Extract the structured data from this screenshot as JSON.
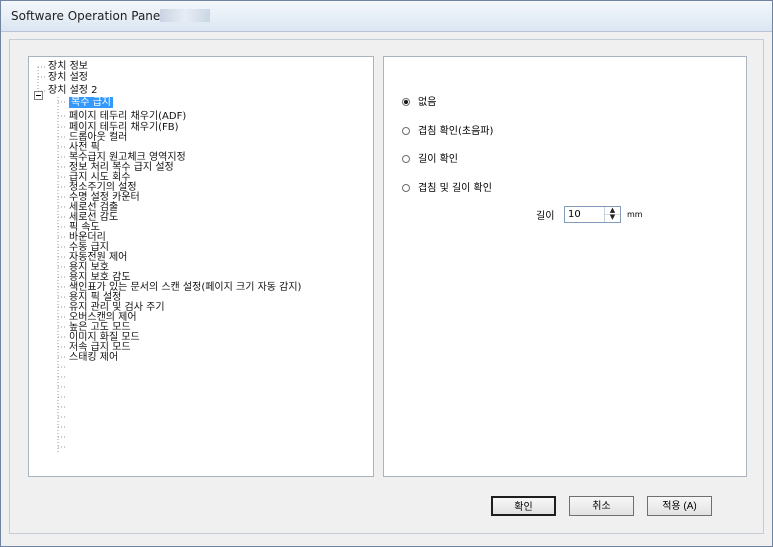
{
  "window": {
    "title": "Software Operation Panel fi-"
  },
  "tree": {
    "items": [
      "장치 정보",
      "장치 설정",
      "장치 설정 2",
      "복수 급지",
      "페이지 테두리 채우기(ADF)",
      "페이지 테두리 채우기(FB)",
      "드롭아웃 컬러",
      "사전 픽",
      "복수급지 원고체크 영역지정",
      "정보 처리 복수 급지 설정",
      "급지 시도 회수",
      "청소주기의 설정",
      "수명 설정 카운터",
      "세로선 검출",
      "세로선 감도",
      "픽 속도",
      "바운더리",
      "수동 급지",
      "자동전원 제어",
      "용지 보호",
      "용지 보호 감도",
      "색인표가 있는 문서의 스캔 설정(페이지 크기 자동 감지)",
      "용지 픽 설정",
      "유지 관리 및 검사 주기",
      "오버스캔의 제어",
      "높은 고도 모드",
      "이미지 화질 모드",
      "저속 급지 모드",
      "스태킹 제어"
    ],
    "selected_index": 3
  },
  "options": {
    "choices": [
      "없음",
      "겹침 확인(초음파)",
      "길이 확인",
      "겹침 및 길이 확인"
    ],
    "selected": "없음",
    "length_label": "길이",
    "length_value": "10",
    "length_unit": "mm"
  },
  "buttons": {
    "ok": "확인",
    "cancel": "취소",
    "apply": "적용 (A)"
  }
}
